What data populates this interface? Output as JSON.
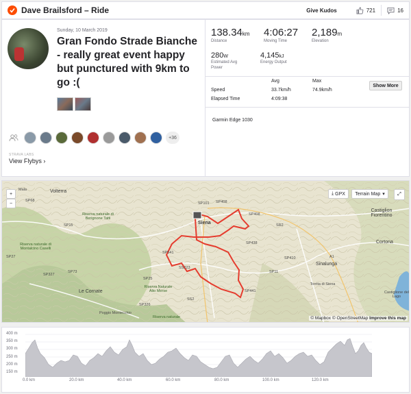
{
  "header": {
    "title": "Dave Brailsford – Ride",
    "give_kudos": "Give Kudos",
    "kudos_count": "721",
    "comment_count": "16"
  },
  "activity": {
    "date": "Sunday, 10 March 2019",
    "title": "Gran Fondo Strade Bianche - really great event happy but punctured with 9km to go :(",
    "athletes_more": "+36",
    "flyby_caption": "STRAVA LABS",
    "flyby_link": "View Flybys ›"
  },
  "stats": {
    "distance": {
      "value": "138.34",
      "unit": "km",
      "label": "Distance"
    },
    "moving_time": {
      "value": "4:06:27",
      "label": "Moving Time"
    },
    "elevation": {
      "value": "2,189",
      "unit": "m",
      "label": "Elevation"
    },
    "power": {
      "value": "280",
      "unit": "W",
      "label1": "Estimated Avg",
      "label2": "Power"
    },
    "energy": {
      "value": "4,145",
      "unit": "kJ",
      "label": "Energy Output"
    },
    "table": {
      "col_avg": "Avg",
      "col_max": "Max",
      "speed_label": "Speed",
      "speed_avg": "33.7km/h",
      "speed_max": "74.9km/h",
      "elapsed_label": "Elapsed Time",
      "elapsed_avg": "4:09:38"
    },
    "show_more": "Show More",
    "device": "Garmin Edge 1030"
  },
  "map": {
    "gpx": "GPX",
    "terrain": "Terrain Map",
    "zoom_in": "+",
    "zoom_out": "−",
    "attribution_mapbox": "© Mapbox",
    "attribution_osm": "© OpenStreetMap",
    "attribution_improve": "Improve this map",
    "labels": {
      "volterra": "Volterra",
      "siena": "Siena",
      "castiglion": "Castiglion Fiorentino",
      "cortona": "Cortona",
      "sinalunga": "Sinalunga",
      "torrita": "Torrita di Siena",
      "castiglione_lago": "Castiglione del Lago",
      "riserva_berignone": "Riserva naturale di Berignone Tatti",
      "riserva_montalcino": "Riserva naturale di Montalcino Caselli",
      "riserva_alto_merse": "Riserva Naturale Alto Merse",
      "le_cornate": "Le Cornate",
      "poggio": "Poggio Montecchio",
      "riserva_crete": "Riserva naturale",
      "mala": "Mala",
      "sp_labels": [
        "SP68",
        "SP15",
        "SP27",
        "SP541",
        "SP73",
        "SP441",
        "SP438",
        "SP327",
        "SP326",
        "SS2",
        "SS223",
        "SP101",
        "SP408",
        "SP410",
        "SP11",
        "A1",
        "SP25",
        "SP408",
        "SR2"
      ]
    }
  },
  "elevation_chart": {
    "y_labels": [
      "400 m",
      "350 m",
      "300 m",
      "250 m",
      "200 m",
      "150 m"
    ],
    "x_labels": [
      "0.0 km",
      "20.0 km",
      "40.0 km",
      "60.0 km",
      "80.0 km",
      "100.0 km",
      "120.0 km"
    ]
  }
}
